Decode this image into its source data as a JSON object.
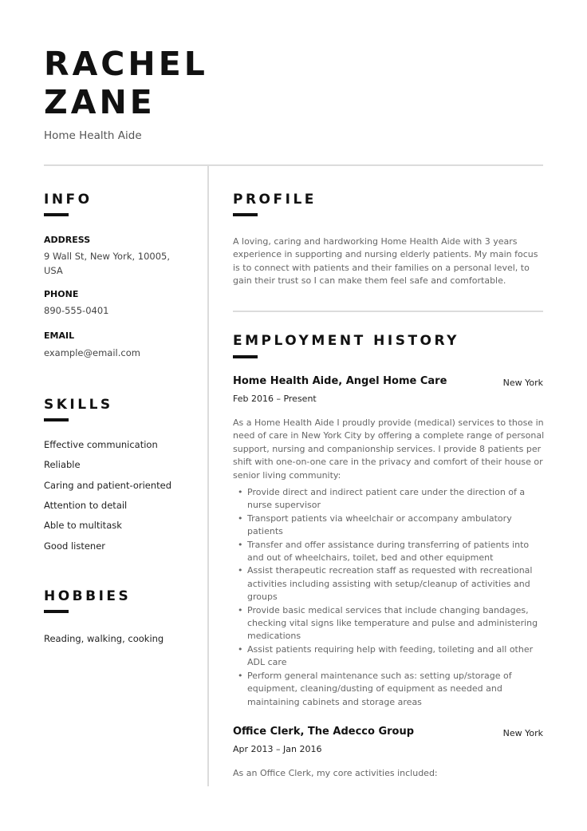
{
  "header": {
    "name_line1": "RACHEL",
    "name_line2": "ZANE",
    "job_title": "Home Health Aide"
  },
  "sidebar": {
    "info": {
      "heading": "INFO",
      "address_label": "ADDRESS",
      "address_line1": "9 Wall St, New York, 10005,",
      "address_line2": "USA",
      "phone_label": "PHONE",
      "phone": "890-555-0401",
      "email_label": "EMAIL",
      "email": "example@email.com"
    },
    "skills": {
      "heading": "SKILLS",
      "items": [
        "Effective communication",
        "Reliable",
        "Caring and patient-oriented",
        "Attention to detail",
        "Able to multitask",
        "Good listener"
      ]
    },
    "hobbies": {
      "heading": "HOBBIES",
      "text": "Reading, walking, cooking"
    }
  },
  "main": {
    "profile": {
      "heading": "PROFILE",
      "text": "A loving, caring and hardworking Home Health Aide with 3 years experience in supporting and nursing elderly patients. My main focus is to connect with patients and their families on a personal level, to gain their trust so I can make them feel safe and comfortable."
    },
    "employment": {
      "heading": "EMPLOYMENT HISTORY",
      "jobs": [
        {
          "title": "Home Health Aide, Angel Home Care",
          "location": "New York",
          "dates": "Feb 2016 – Present",
          "description": "As a Home Health Aide I proudly provide (medical) services to those in need of care in New York City by offering a complete range of personal support, nursing and companionship services. I provide 8 patients per shift with one-on-one care in the privacy and comfort of their house or senior living community:",
          "bullets": [
            "Provide direct and indirect patient care under the direction of a nurse supervisor",
            "Transport patients via wheelchair or accompany ambulatory patients",
            "Transfer and offer assistance during transferring of patients into and out of wheelchairs, toilet, bed and other equipment",
            "Assist therapeutic recreation staff as requested with recreational activities including assisting with setup/cleanup of activities and groups",
            "Provide basic medical services that include changing bandages, checking vital signs like temperature and pulse and administering medications",
            "Assist patients requiring help with feeding, toileting and all other ADL care",
            "Perform general maintenance such as: setting up/storage of equipment, cleaning/dusting of equipment as needed and maintaining cabinets and storage areas"
          ]
        },
        {
          "title": "Office Clerk, The Adecco Group",
          "location": "New York",
          "dates": "Apr 2013 – Jan 2016",
          "description": "As an Office Clerk, my core activities included:"
        }
      ]
    }
  }
}
